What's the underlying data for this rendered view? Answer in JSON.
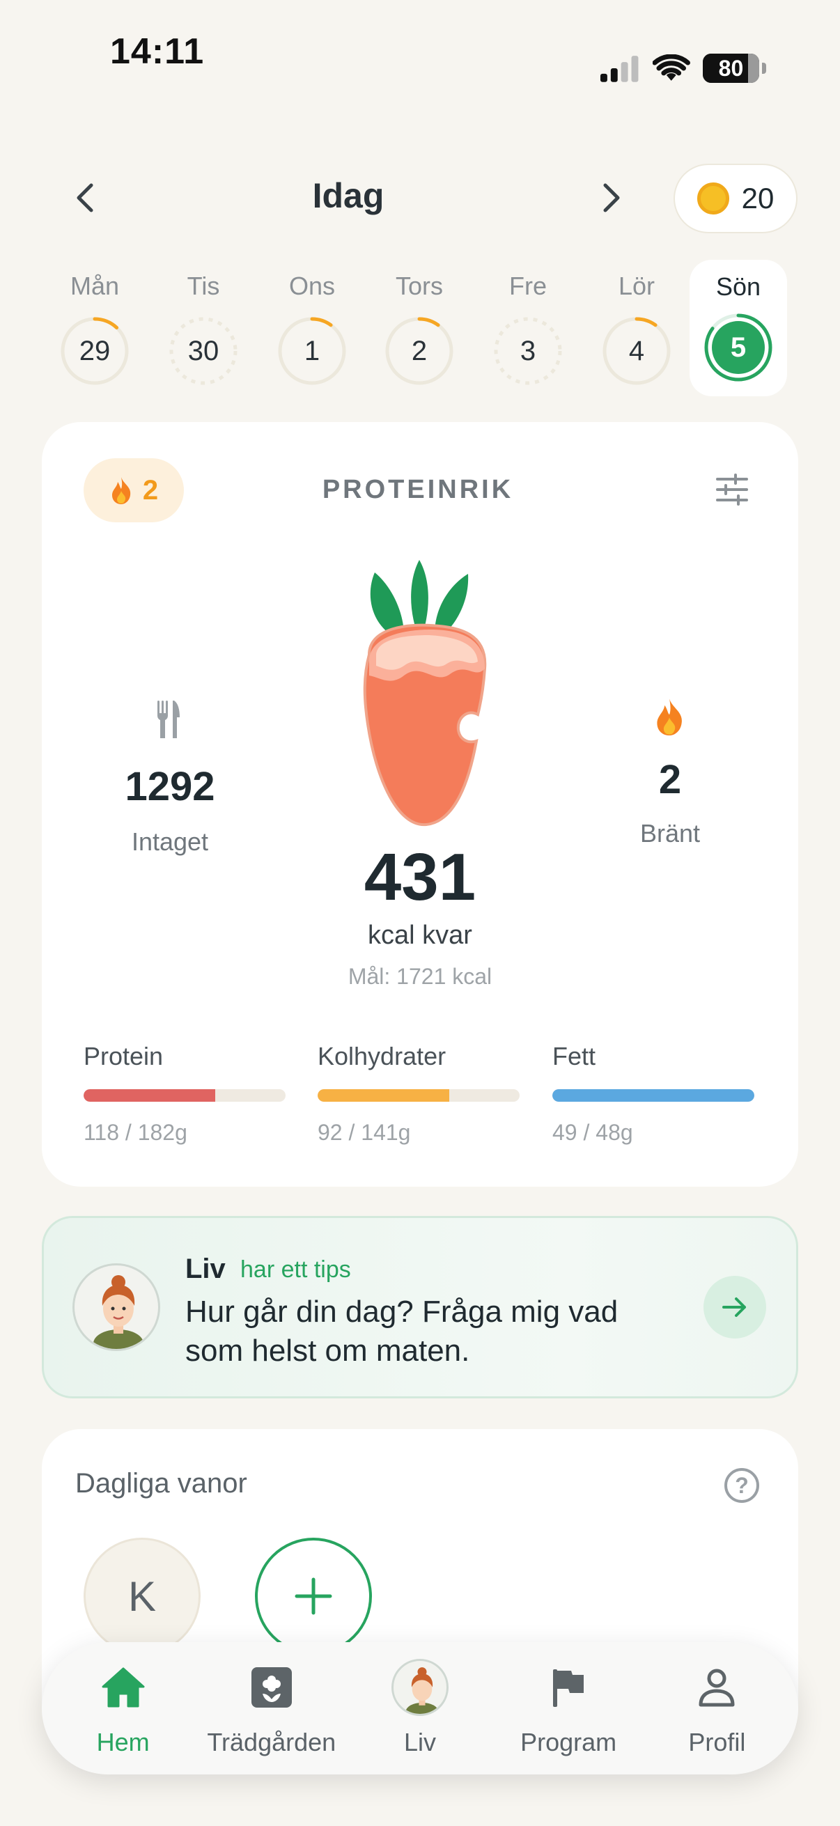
{
  "status_bar": {
    "time": "14:11",
    "battery": "80",
    "icons": [
      "signal-icon",
      "wifi-icon",
      "battery-icon"
    ]
  },
  "header": {
    "title": "Idag",
    "coins": "20",
    "prev_icon": "chevron-left-icon",
    "next_icon": "chevron-right-icon"
  },
  "week": [
    {
      "label": "Mån",
      "date": "29",
      "progress": 0.12
    },
    {
      "label": "Tis",
      "date": "30",
      "progress": 0
    },
    {
      "label": "Ons",
      "date": "1",
      "progress": 0.1
    },
    {
      "label": "Tors",
      "date": "2",
      "progress": 0.1
    },
    {
      "label": "Fre",
      "date": "3",
      "progress": 0
    },
    {
      "label": "Lör",
      "date": "4",
      "progress": 0.1
    },
    {
      "label": "Sön",
      "date": "5",
      "progress": 0.85,
      "selected": true
    }
  ],
  "summary": {
    "streak": "2",
    "plan": "PROTEINRIK",
    "intake_value": "1292",
    "intake_label": "Intaget",
    "burned_value": "2",
    "burned_label": "Bränt",
    "kcal_left": "431",
    "kcal_left_label": "kcal kvar",
    "goal": "Mål: 1721 kcal",
    "macros": [
      {
        "name": "Protein",
        "value": "118 / 182g",
        "fraction": 0.65,
        "color": "#e06461"
      },
      {
        "name": "Kolhydrater",
        "value": "92 / 141g",
        "fraction": 0.65,
        "color": "#f7b144"
      },
      {
        "name": "Fett",
        "value": "49 / 48g",
        "fraction": 1.0,
        "color": "#5ba8e0"
      }
    ]
  },
  "tip": {
    "name": "Liv",
    "subtitle": "har ett tips",
    "text": "Hur går din dag? Fråga mig vad som helst om maten."
  },
  "habits": {
    "title": "Dagliga vanor",
    "items": [
      {
        "initial": "K"
      }
    ]
  },
  "tabbar": {
    "tabs": [
      {
        "label": "Hem",
        "icon": "home-icon",
        "active": true
      },
      {
        "label": "Trädgården",
        "icon": "garden-icon"
      },
      {
        "label": "Liv",
        "icon": "avatar-icon"
      },
      {
        "label": "Program",
        "icon": "flag-icon"
      },
      {
        "label": "Profil",
        "icon": "person-icon"
      }
    ]
  },
  "colors": {
    "accent": "#27a45f",
    "background": "#f7f5f0",
    "ring": "#f6a623"
  }
}
